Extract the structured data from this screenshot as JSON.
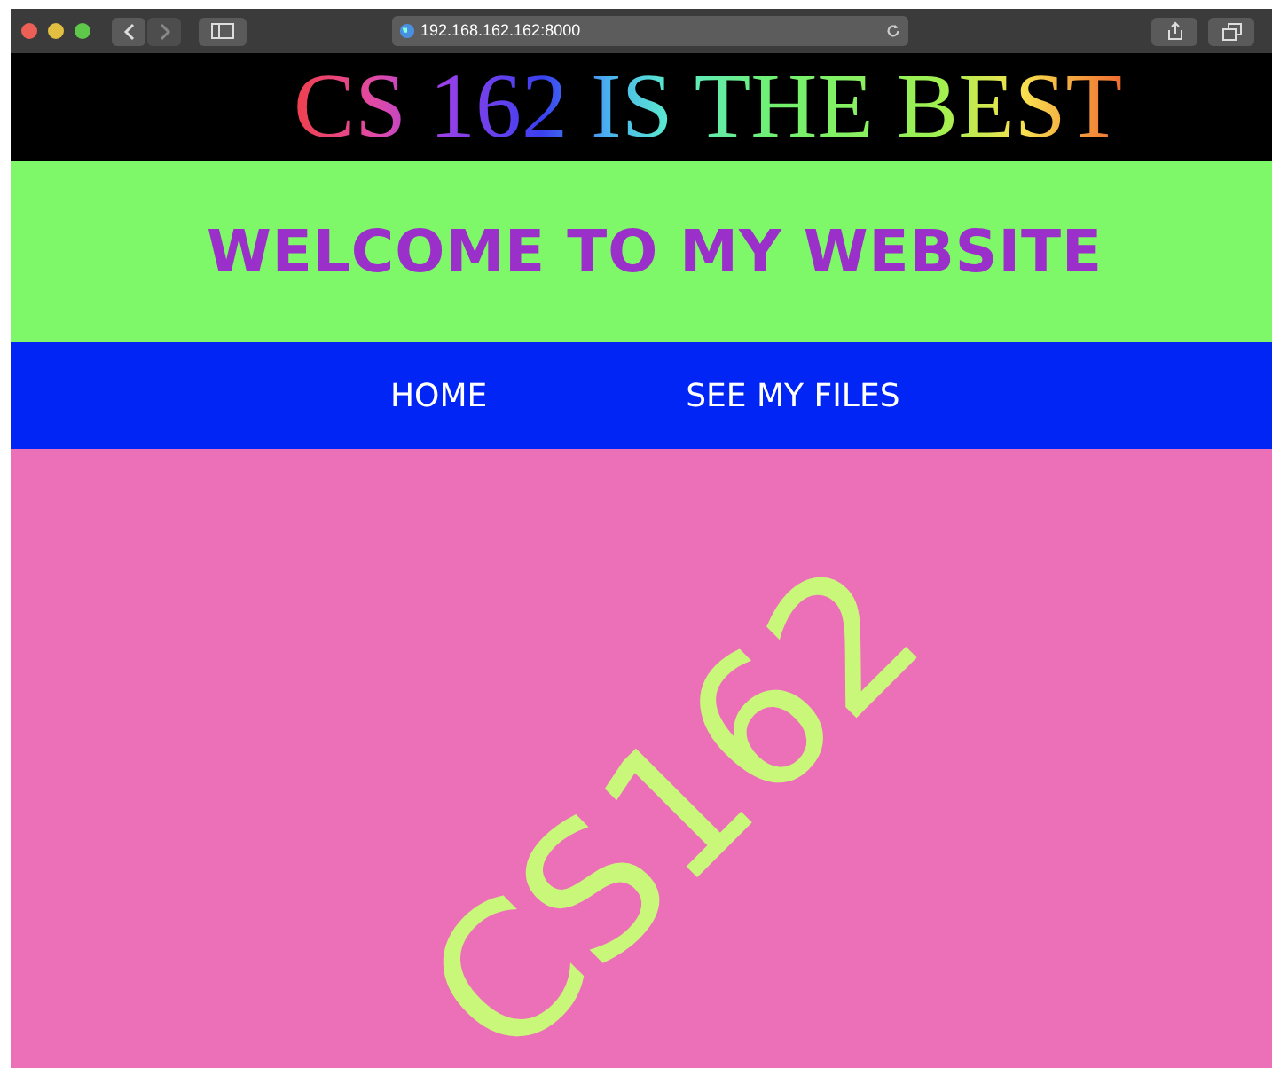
{
  "browser": {
    "address": "192.168.162.162:8000"
  },
  "banner": {
    "title": "CS 162 IS THE BEST"
  },
  "header": {
    "heading": "WELCOME TO MY WEBSITE"
  },
  "nav": [
    {
      "label": "HOME"
    },
    {
      "label": "SEE MY FILES"
    }
  ],
  "main": {
    "graphic_text": "CS162"
  }
}
